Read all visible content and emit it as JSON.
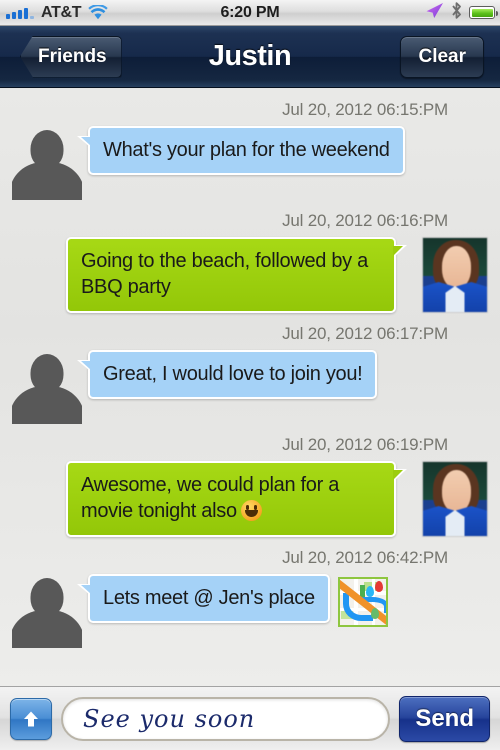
{
  "status_bar": {
    "carrier": "AT&T",
    "time": "6:20 PM",
    "signal_icon": "signal-bars-icon",
    "wifi_icon": "wifi-icon",
    "location_icon": "location-arrow-icon",
    "bluetooth_icon": "bluetooth-icon",
    "battery_icon": "battery-full-icon"
  },
  "nav_bar": {
    "back_label": "Friends",
    "title": "Justin",
    "clear_label": "Clear"
  },
  "messages": [
    {
      "timestamp": "Jul 20, 2012 06:15:PM",
      "text": "What's your plan for the weekend",
      "direction": "incoming",
      "avatar": "silhouette-avatar",
      "attachment": null
    },
    {
      "timestamp": "Jul 20, 2012 06:16:PM",
      "text": "Going to the beach, followed by a BBQ party",
      "direction": "outgoing",
      "avatar": "photo-avatar",
      "attachment": null
    },
    {
      "timestamp": "Jul 20, 2012 06:17:PM",
      "text": "Great, I would love to join you!",
      "direction": "incoming",
      "avatar": "silhouette-avatar",
      "attachment": null
    },
    {
      "timestamp": "Jul 20, 2012 06:19:PM",
      "text": "Awesome, we could plan for a movie tonight also",
      "direction": "outgoing",
      "avatar": "photo-avatar",
      "emoji": "grinning-face",
      "attachment": null
    },
    {
      "timestamp": "Jul 20, 2012 06:42:PM",
      "text": "Lets meet @ Jen's place",
      "direction": "incoming",
      "avatar": "silhouette-avatar",
      "attachment": "map-thumbnail"
    }
  ],
  "toolbar": {
    "attach_icon": "up-arrow-icon",
    "input_value": "See you soon",
    "input_placeholder": "",
    "send_label": "Send"
  },
  "colors": {
    "incoming_bubble": "#a5d2f7",
    "outgoing_bubble": "#9ccd0d",
    "nav_bar": "#16294a",
    "send_button": "#22419a",
    "battery_green": "#5cc01c",
    "signal_blue": "#1a6fd4"
  }
}
